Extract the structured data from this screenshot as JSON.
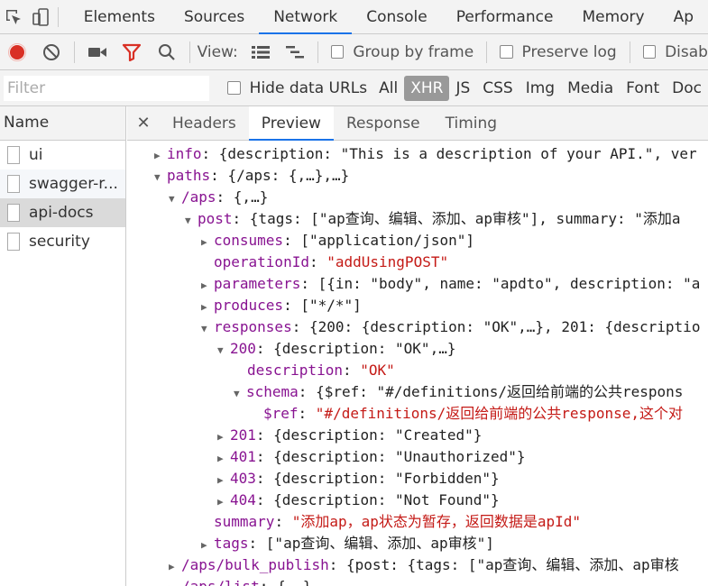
{
  "devtools_tabs": [
    "Elements",
    "Sources",
    "Network",
    "Console",
    "Performance",
    "Memory",
    "Ap"
  ],
  "active_tab": "Network",
  "toolbar": {
    "view_label": "View:",
    "group_by_frame": "Group by frame",
    "preserve_log": "Preserve log",
    "disable": "Disab"
  },
  "filter": {
    "placeholder": "Filter",
    "hide_data_urls": "Hide data URLs",
    "types": [
      "All",
      "XHR",
      "JS",
      "CSS",
      "Img",
      "Media",
      "Font",
      "Doc"
    ],
    "active_type": "XHR"
  },
  "requests": {
    "header": "Name",
    "items": [
      "ui",
      "swagger-r...",
      "api-docs",
      "security"
    ],
    "selected": "api-docs"
  },
  "detail_tabs": [
    "Headers",
    "Preview",
    "Response",
    "Timing"
  ],
  "active_detail_tab": "Preview",
  "colors": {
    "key": "#881391",
    "string": "#c41a16",
    "accent": "#1a73e8",
    "record": "#d93025",
    "filter": "#d93025"
  },
  "tree": [
    {
      "tri": "right",
      "key": "info",
      "rest": ": {description: \"This is a description of your API.\", ver"
    },
    {
      "tri": "down",
      "key": "paths",
      "rest": ": {/aps: {,…},…}"
    },
    {
      "tri": "down",
      "key": "/aps",
      "rest": ": {,…}"
    },
    {
      "tri": "down",
      "key": "post",
      "rest": ": {tags: [\"ap查询、编辑、添加、ap审核\"], summary: \"添加a"
    },
    {
      "tri": "right",
      "key": "consumes",
      "rest": ": [\"application/json\"]"
    },
    {
      "tri": "",
      "key": "operationId",
      "str": "\"addUsingPOST\""
    },
    {
      "tri": "right",
      "key": "parameters",
      "rest": ": [{in: \"body\", name: \"apdto\", description: \"a"
    },
    {
      "tri": "right",
      "key": "produces",
      "rest": ": [\"*/*\"]"
    },
    {
      "tri": "down",
      "key": "responses",
      "rest": ": {200: {description: \"OK\",…}, 201: {descriptio"
    },
    {
      "tri": "down",
      "key": "200",
      "rest": ": {description: \"OK\",…}"
    },
    {
      "tri": "",
      "key": "description",
      "str": "\"OK\""
    },
    {
      "tri": "down",
      "key": "schema",
      "rest": ": {$ref: \"#/definitions/返回给前端的公共respons"
    },
    {
      "tri": "",
      "key": "$ref",
      "str": "\"#/definitions/返回给前端的公共response,这个对"
    },
    {
      "tri": "right",
      "key": "201",
      "rest": ": {description: \"Created\"}"
    },
    {
      "tri": "right",
      "key": "401",
      "rest": ": {description: \"Unauthorized\"}"
    },
    {
      "tri": "right",
      "key": "403",
      "rest": ": {description: \"Forbidden\"}"
    },
    {
      "tri": "right",
      "key": "404",
      "rest": ": {description: \"Not Found\"}"
    },
    {
      "tri": "",
      "key": "summary",
      "str": "\"添加ap，ap状态为暂存，返回数据是apId\""
    },
    {
      "tri": "right",
      "key": "tags",
      "rest": ": [\"ap查询、编辑、添加、ap审核\"]"
    },
    {
      "tri": "right",
      "key": "/aps/bulk_publish",
      "rest": ": {post: {tags: [\"ap查询、编辑、添加、ap审核"
    },
    {
      "tri": "right",
      "key": "/aps/list",
      "rest": ": {,…}"
    }
  ]
}
